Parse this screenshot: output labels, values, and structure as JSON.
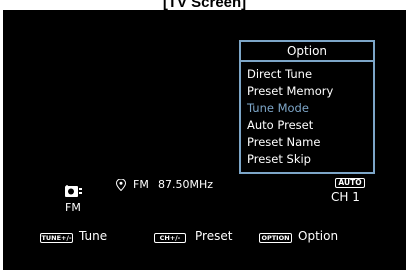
{
  "caption": "[TV Screen]",
  "option_menu": {
    "title": "Option",
    "items": [
      {
        "label": "Direct Tune",
        "selected": false
      },
      {
        "label": "Preset Memory",
        "selected": false
      },
      {
        "label": "Tune Mode",
        "selected": true
      },
      {
        "label": "Auto Preset",
        "selected": false
      },
      {
        "label": "Preset Name",
        "selected": false
      },
      {
        "label": "Preset Skip",
        "selected": false
      }
    ]
  },
  "status": {
    "band": "FM",
    "band_under_icon": "FM",
    "frequency": "87.50MHz",
    "tune_mode_badge": "AUTO",
    "channel": "CH 1",
    "icons": [
      "tuner-icon",
      "location-pin-icon"
    ]
  },
  "footer": {
    "tune_key": "TUNE+/-",
    "tune_label": "Tune",
    "preset_key": "CH+/-",
    "preset_label": "Preset",
    "option_key": "OPTION",
    "option_label": "Option"
  },
  "colors": {
    "background": "#000000",
    "accent": "#7da6c8",
    "text": "#ffffff"
  }
}
